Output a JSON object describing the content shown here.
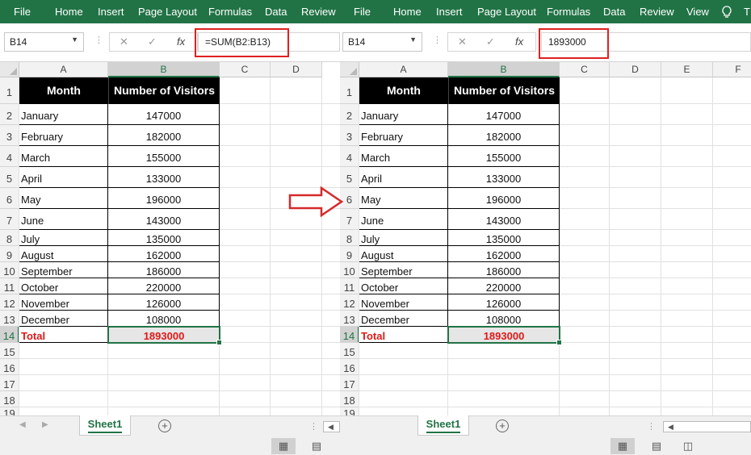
{
  "ribbon_left": [
    "File",
    "Home",
    "Insert",
    "Page Layout",
    "Formulas",
    "Data",
    "Review"
  ],
  "ribbon_right": [
    "File",
    "Home",
    "Insert",
    "Page Layout",
    "Formulas",
    "Data",
    "Review",
    "View",
    "T"
  ],
  "left": {
    "name_box": "B14",
    "formula": "=SUM(B2:B13)",
    "columns": [
      "A",
      "B",
      "C",
      "D"
    ],
    "sheet_tab": "Sheet1"
  },
  "right": {
    "name_box": "B14",
    "formula": "1893000",
    "columns": [
      "A",
      "B",
      "C",
      "D",
      "E",
      "F"
    ],
    "sheet_tab": "Sheet1"
  },
  "icons": {
    "cancel": "✕",
    "enter": "✓",
    "fx": "fx",
    "tell_me": "lightbulb-icon",
    "add_sheet": "+",
    "normal_view": "grid-icon",
    "page_layout_view": "page-icon",
    "page_break_view": "page-break-icon"
  },
  "table": {
    "headers": [
      "Month",
      "Number of Visitors"
    ],
    "rows": [
      [
        "January",
        "147000"
      ],
      [
        "February",
        "182000"
      ],
      [
        "March",
        "155000"
      ],
      [
        "April",
        "133000"
      ],
      [
        "May",
        "196000"
      ],
      [
        "June",
        "143000"
      ],
      [
        "July",
        "135000"
      ],
      [
        "August",
        "162000"
      ],
      [
        "September",
        "186000"
      ],
      [
        "October",
        "220000"
      ],
      [
        "November",
        "126000"
      ],
      [
        "December",
        "108000"
      ]
    ],
    "total_label": "Total",
    "total_value": "1893000"
  },
  "row_numbers": [
    "1",
    "2",
    "3",
    "4",
    "5",
    "6",
    "7",
    "8",
    "9",
    "10",
    "11",
    "12",
    "13",
    "14",
    "15",
    "16",
    "17",
    "18",
    "19"
  ],
  "colors": {
    "ribbon": "#217346",
    "accent": "#217346",
    "highlight": "#e02020",
    "total_text": "#e01818"
  }
}
